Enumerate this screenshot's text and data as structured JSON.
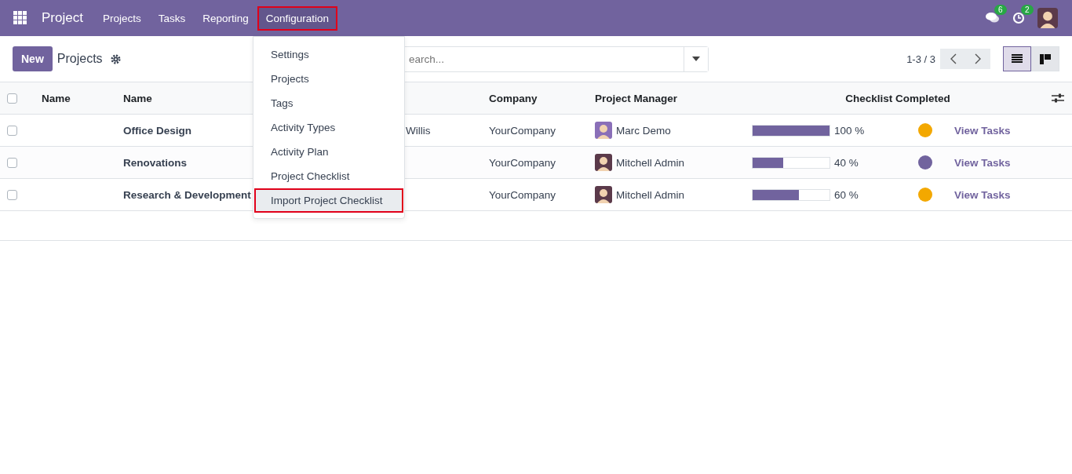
{
  "navbar": {
    "app": "Project",
    "menu": [
      {
        "label": "Projects",
        "highlighted": false
      },
      {
        "label": "Tasks",
        "highlighted": false
      },
      {
        "label": "Reporting",
        "highlighted": false
      },
      {
        "label": "Configuration",
        "highlighted": true
      }
    ],
    "badges": [
      {
        "kind": "chat",
        "count": "6"
      },
      {
        "kind": "activity",
        "count": "2"
      }
    ]
  },
  "control_panel": {
    "new_button": "New",
    "title": "Projects",
    "search": {
      "placeholder": "earch..."
    },
    "pager": "1-3 / 3",
    "views": [
      {
        "kind": "list",
        "selected": true
      },
      {
        "kind": "kanban",
        "selected": false
      }
    ]
  },
  "dropdown": [
    {
      "label": "Settings",
      "highlighted": false
    },
    {
      "label": "Projects",
      "highlighted": false
    },
    {
      "label": "Tags",
      "highlighted": false
    },
    {
      "label": "Activity Types",
      "highlighted": false
    },
    {
      "label": "Activity Plan",
      "highlighted": false
    },
    {
      "label": "Project Checklist",
      "highlighted": false
    },
    {
      "label": "Import Project Checklist",
      "highlighted": true
    }
  ],
  "table": {
    "select_all_checked": false,
    "columns": [
      "Name",
      "Name",
      "Company",
      "Project Manager",
      "Checklist Completed"
    ],
    "rows": [
      {
        "checked": false,
        "name": "Office Design",
        "column_3": "Willis",
        "company": "YourCompany",
        "manager": "Marc Demo",
        "level": 1.0,
        "reading": "100 %",
        "color": "#f3a800",
        "action": "View Tasks"
      },
      {
        "checked": false,
        "name": "Renovations",
        "company": "YourCompany",
        "manager": "Mitchell Admin",
        "level": 0.4,
        "reading": "40 %",
        "color": "#71639e",
        "action": "View Tasks"
      },
      {
        "checked": false,
        "name": "Research & Development",
        "company": "YourCompany",
        "manager": "Mitchell Admin",
        "level": 0.6,
        "reading": "60 %",
        "color": "#f3a800",
        "action": "View Tasks"
      }
    ]
  }
}
